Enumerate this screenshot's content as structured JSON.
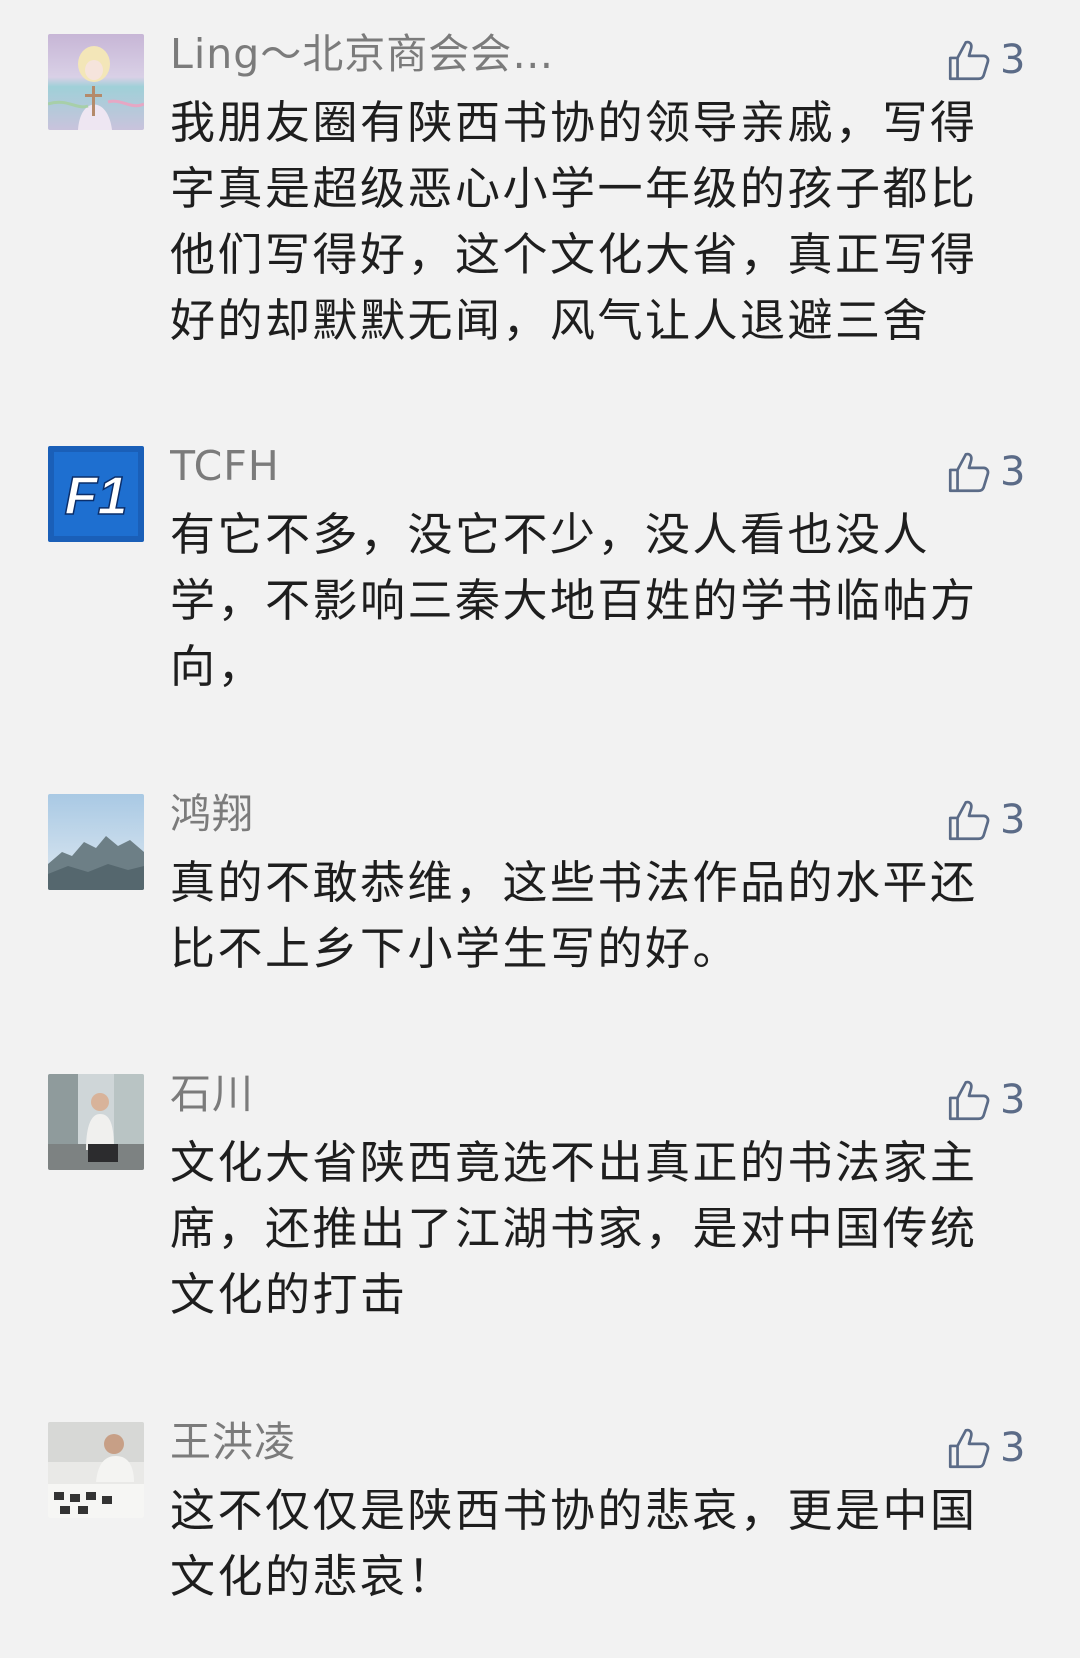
{
  "comments": [
    {
      "nickname": "Ling～北京商会会…",
      "likes": "3",
      "content": "我朋友圈有陕西书协的领导亲戚，写得字真是超级恶心小学一年级的孩子都比他们写得好，这个文化大省，真正写得好的却默默无闻，风气让人退避三舍"
    },
    {
      "nickname": "TCFH",
      "likes": "3",
      "avatar_text": "F1",
      "content": "有它不多，没它不少，没人看也没人学，不影响三秦大地百姓的学书临帖方向，"
    },
    {
      "nickname": "鸿翔",
      "likes": "3",
      "content": "真的不敢恭维，这些书法作品的水平还比不上乡下小学生写的好。"
    },
    {
      "nickname": "石川",
      "likes": "3",
      "content": "文化大省陕西竟选不出真正的书法家主席，还推出了江湖书家，是对中国传统文化的打击"
    },
    {
      "nickname": "王洪凌",
      "likes": "3",
      "content": "这不仅仅是陕西书协的悲哀，更是中国文化的悲哀！"
    }
  ],
  "icons": {
    "like": "thumbs-up-icon"
  },
  "colors": {
    "background": "#f2f2f2",
    "nickname": "#7b7b7b",
    "content": "#1e1e1e",
    "like": "#5b6b87"
  }
}
